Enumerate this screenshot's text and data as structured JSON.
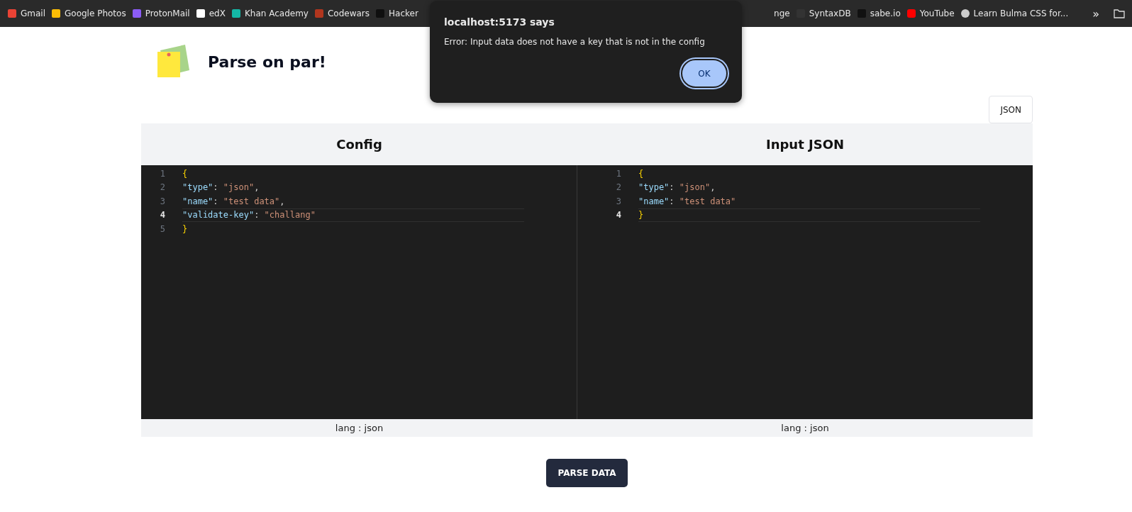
{
  "bookmarks_bar": {
    "left": [
      {
        "label": "Gmail"
      },
      {
        "label": "Google Photos"
      },
      {
        "label": "ProtonMail"
      },
      {
        "label": "edX"
      },
      {
        "label": "Khan Academy"
      },
      {
        "label": "Codewars"
      },
      {
        "label": "Hacker"
      }
    ],
    "right": [
      {
        "label": "nge"
      },
      {
        "label": "SyntaxDB"
      },
      {
        "label": "sabe.io"
      },
      {
        "label": "YouTube"
      },
      {
        "label": "Learn Bulma CSS for..."
      }
    ],
    "overflow": "»"
  },
  "header": {
    "title": "Parse on par!"
  },
  "mode_button": "JSON",
  "editors": [
    {
      "title": "Config",
      "footer": "lang : json",
      "lines": [
        {
          "number": "1",
          "active": false,
          "tokens": [
            {
              "kind": "brace",
              "text": "{"
            }
          ]
        },
        {
          "number": "2",
          "active": false,
          "tokens": [
            {
              "kind": "key",
              "text": "\"type\""
            },
            {
              "kind": "punct",
              "text": ": "
            },
            {
              "kind": "string",
              "text": "\"json\""
            },
            {
              "kind": "punct",
              "text": ","
            }
          ]
        },
        {
          "number": "3",
          "active": false,
          "tokens": [
            {
              "kind": "key",
              "text": "\"name\""
            },
            {
              "kind": "punct",
              "text": ": "
            },
            {
              "kind": "string",
              "text": "\"test data\""
            },
            {
              "kind": "punct",
              "text": ","
            }
          ]
        },
        {
          "number": "4",
          "active": true,
          "tokens": [
            {
              "kind": "key",
              "text": "\"validate-key\""
            },
            {
              "kind": "punct",
              "text": ": "
            },
            {
              "kind": "string",
              "text": "\"challang\""
            }
          ]
        },
        {
          "number": "5",
          "active": false,
          "tokens": [
            {
              "kind": "brace",
              "text": "}"
            }
          ]
        }
      ]
    },
    {
      "title": "Input JSON",
      "footer": "lang : json",
      "lines": [
        {
          "number": "1",
          "active": false,
          "tokens": [
            {
              "kind": "brace",
              "text": "{"
            }
          ]
        },
        {
          "number": "2",
          "active": false,
          "tokens": [
            {
              "kind": "key",
              "text": "\"type\""
            },
            {
              "kind": "punct",
              "text": ": "
            },
            {
              "kind": "string",
              "text": "\"json\""
            },
            {
              "kind": "punct",
              "text": ","
            }
          ]
        },
        {
          "number": "3",
          "active": false,
          "tokens": [
            {
              "kind": "key",
              "text": "\"name\""
            },
            {
              "kind": "punct",
              "text": ": "
            },
            {
              "kind": "string",
              "text": "\"test data\""
            }
          ]
        },
        {
          "number": "4",
          "active": true,
          "tokens": [
            {
              "kind": "brace",
              "text": "}"
            }
          ]
        }
      ]
    }
  ],
  "parse_button": "PARSE DATA",
  "alert": {
    "title": "localhost:5173 says",
    "message": "Error: Input data does not have a key that is not in the config",
    "button": "OK"
  }
}
